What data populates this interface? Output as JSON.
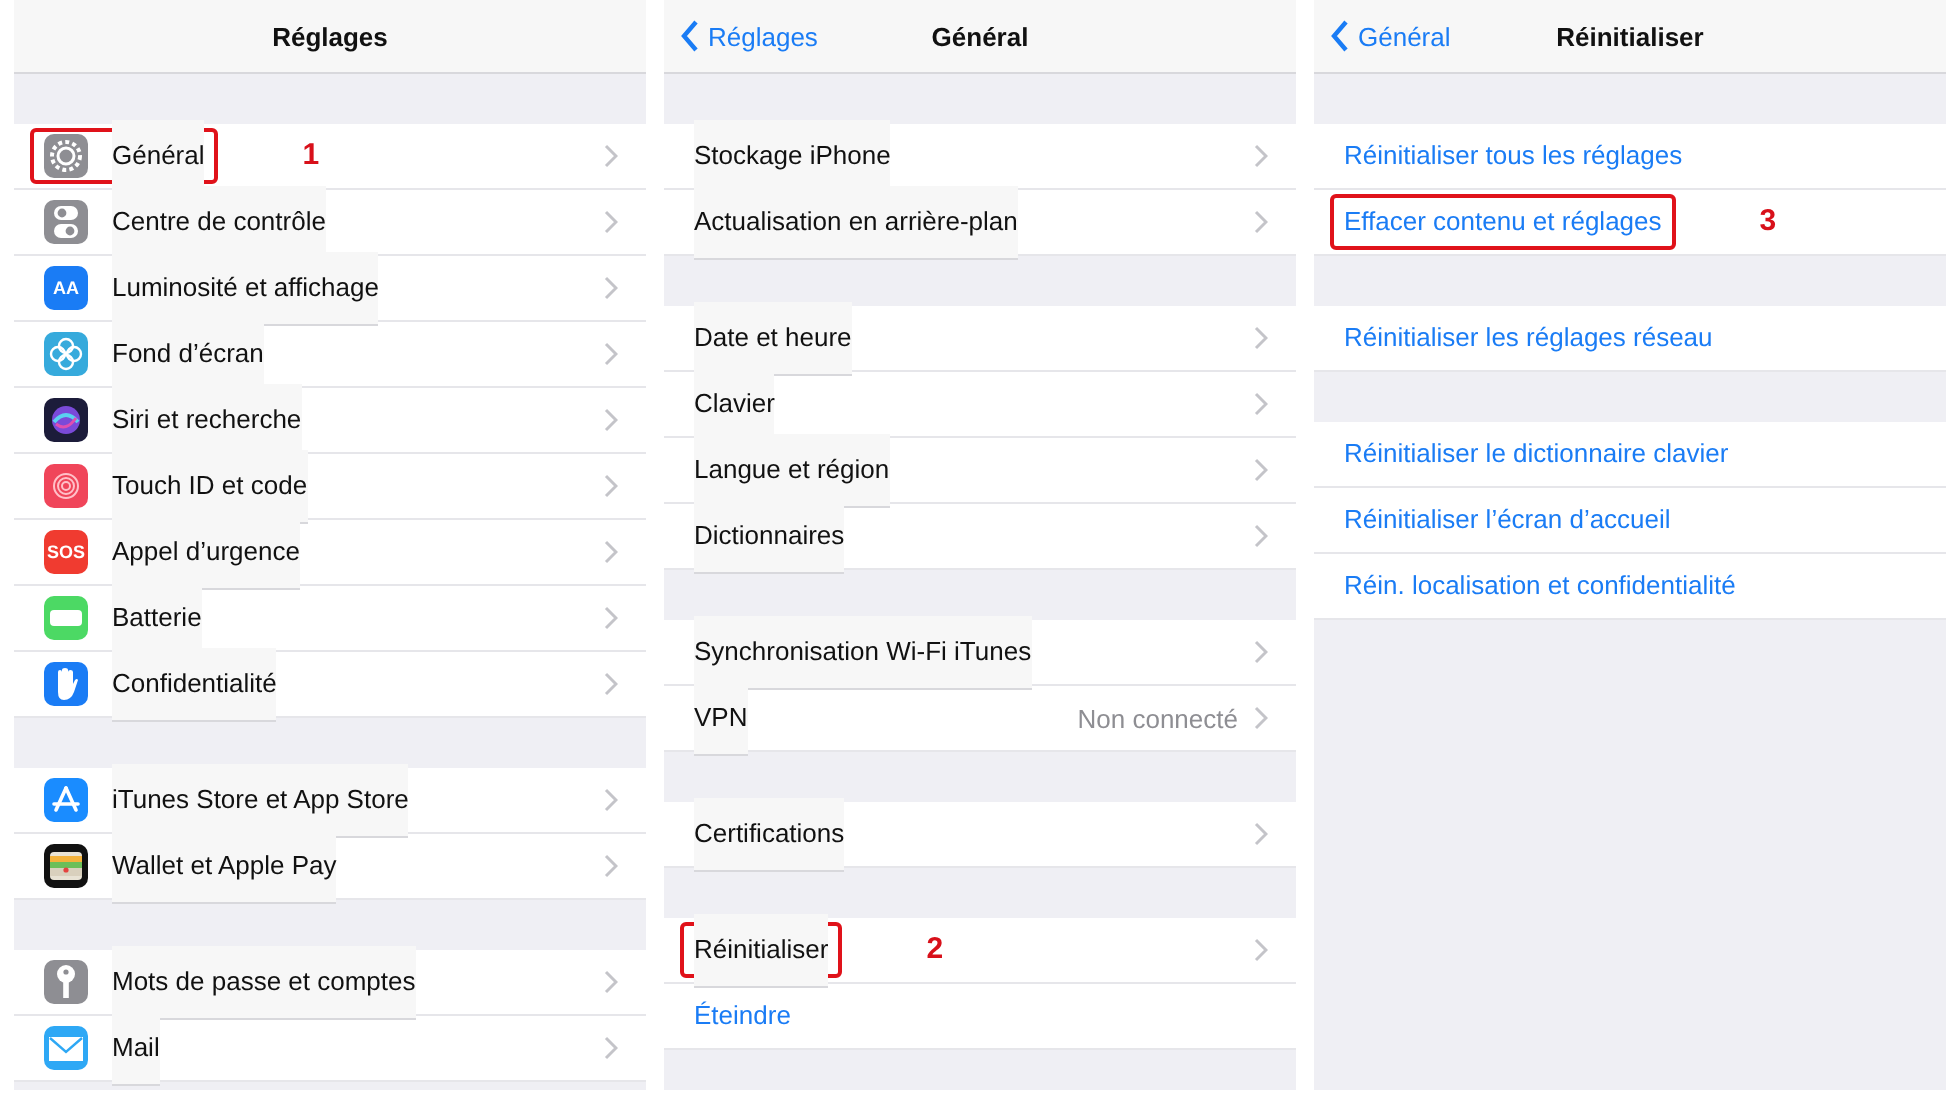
{
  "panels": [
    {
      "title": "Réglages",
      "groups": [
        [
          {
            "kind": "nav",
            "label": "Général",
            "highlighted": true,
            "step": "1"
          },
          {
            "kind": "nav",
            "label": "Centre de contrôle",
            "highlighted": false
          },
          {
            "kind": "nav",
            "icon_text": "AA",
            "label": "Luminosité et affichage",
            "highlighted": false
          },
          {
            "kind": "nav",
            "label": "Fond d’écran",
            "highlighted": false
          },
          {
            "kind": "nav",
            "label": "Siri et recherche",
            "highlighted": false
          },
          {
            "kind": "nav",
            "label": "Touch ID et code",
            "highlighted": false
          },
          {
            "kind": "nav",
            "icon_text": "SOS",
            "label": "Appel d’urgence",
            "highlighted": false
          },
          {
            "kind": "nav",
            "label": "Batterie",
            "highlighted": false
          },
          {
            "kind": "nav",
            "label": "Confidentialité",
            "highlighted": false
          }
        ],
        [
          {
            "kind": "nav",
            "label": "iTunes Store et App Store",
            "highlighted": false
          },
          {
            "kind": "nav",
            "label": "Wallet et Apple Pay",
            "highlighted": false
          }
        ],
        [
          {
            "kind": "nav",
            "label": "Mots de passe et comptes",
            "highlighted": false
          },
          {
            "kind": "nav",
            "label": "Mail",
            "highlighted": false
          }
        ]
      ]
    },
    {
      "back": "Réglages",
      "title": "Général",
      "groups": [
        [
          {
            "kind": "nav",
            "label": "Stockage iPhone",
            "highlighted": false
          },
          {
            "kind": "nav",
            "label": "Actualisation en arrière-plan",
            "highlighted": false
          }
        ],
        [
          {
            "kind": "nav",
            "label": "Date et heure",
            "highlighted": false
          },
          {
            "kind": "nav",
            "label": "Clavier",
            "highlighted": false
          },
          {
            "kind": "nav",
            "label": "Langue et région",
            "highlighted": false
          },
          {
            "kind": "nav",
            "label": "Dictionnaires",
            "highlighted": false
          }
        ],
        [
          {
            "kind": "nav",
            "label": "Synchronisation Wi-Fi iTunes",
            "highlighted": false
          },
          {
            "kind": "nav",
            "label": "VPN",
            "value": "Non connecté",
            "highlighted": false
          }
        ],
        [
          {
            "kind": "nav",
            "label": "Certifications",
            "highlighted": false
          }
        ],
        [
          {
            "kind": "nav",
            "label": "Réinitialiser",
            "highlighted": true,
            "step": "2"
          },
          {
            "kind": "action",
            "label": "Éteindre",
            "highlighted": false
          }
        ]
      ]
    },
    {
      "back": "Général",
      "title": "Réinitialiser",
      "groups": [
        [
          {
            "kind": "action",
            "label": "Réinitialiser tous les réglages",
            "highlighted": false
          },
          {
            "kind": "action",
            "label": "Effacer contenu et réglages",
            "highlighted": true,
            "step": "3"
          }
        ],
        [
          {
            "kind": "action",
            "label": "Réinitialiser les réglages réseau",
            "highlighted": false
          }
        ],
        [
          {
            "kind": "action",
            "label": "Réinitialiser le dictionnaire clavier",
            "highlighted": false
          },
          {
            "kind": "action",
            "label": "Réinitialiser l’écran d’accueil",
            "highlighted": false
          },
          {
            "kind": "action",
            "label": "Réin. localisation et confidentialité",
            "highlighted": false
          }
        ]
      ]
    }
  ]
}
